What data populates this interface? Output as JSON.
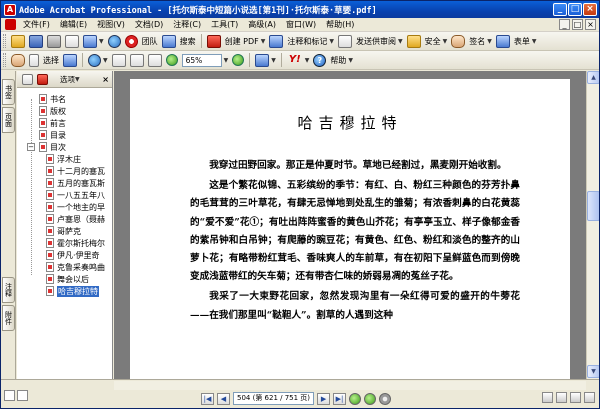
{
  "window": {
    "title": "Adobe Acrobat Professional - [托尔斯泰中短篇小说选[第1刊]·托尔斯泰·草婴.pdf]",
    "app_icon": "acrobat-icon",
    "buttons": [
      "_",
      "□",
      "×"
    ]
  },
  "menu": {
    "items": [
      "文件(F)",
      "编辑(E)",
      "视图(V)",
      "文档(D)",
      "注释(C)",
      "工具(T)",
      "高级(A)",
      "窗口(W)",
      "帮助(H)"
    ],
    "window_buttons": [
      "_",
      "□",
      "×"
    ]
  },
  "toolbar1": {
    "ie_label": "团队",
    "search_label": "搜索",
    "create_pdf_label": "创建 PDF",
    "comment_label": "注释和标记",
    "send_review_label": "发送供审阅",
    "secure_label": "安全",
    "sign_label": "签名",
    "forms_label": "表单"
  },
  "toolbar2": {
    "select_label": "选择",
    "zoom_value": "65%",
    "help_label": "帮助"
  },
  "nav_tabs": [
    "书签",
    "页面",
    "注释",
    "附件"
  ],
  "bookmarks": {
    "header_label": "选项",
    "items": [
      {
        "label": "书名",
        "level": 0
      },
      {
        "label": "版权",
        "level": 0
      },
      {
        "label": "前言",
        "level": 0
      },
      {
        "label": "目录",
        "level": 0
      },
      {
        "label": "目次",
        "level": 0,
        "expanded": true
      },
      {
        "label": "浮木庄",
        "level": 1
      },
      {
        "label": "十二月的塞瓦",
        "level": 1
      },
      {
        "label": "五月的塞瓦斯",
        "level": 1
      },
      {
        "label": "一八五五年八",
        "level": 1
      },
      {
        "label": "一个地主的早",
        "level": 1
      },
      {
        "label": "卢塞恩（聂赫",
        "level": 1
      },
      {
        "label": "哥萨克",
        "level": 1
      },
      {
        "label": "霍尔斯托梅尔",
        "level": 1
      },
      {
        "label": "伊凡·伊里奇",
        "level": 1
      },
      {
        "label": "克鲁采奏鸣曲",
        "level": 1
      },
      {
        "label": "舞会以后",
        "level": 1
      },
      {
        "label": "哈吉穆拉特",
        "level": 1,
        "selected": true
      }
    ]
  },
  "document": {
    "title": "哈吉穆拉特",
    "paragraphs": [
      "我穿过田野回家。那正是仲夏时节。草地已经割过，黑麦刚开始收割。",
      "这是个繁花似锦、五彩缤纷的季节：有红、白、粉红三种颜色的芬芳扑鼻的毛茸茸的三叶草花，有肆无忌惮地到处乱生的雏菊；有浓香刺鼻的白花黄蕊的“爱不爱”花①；有吐出阵阵蜜香的黄色山芥花；有亭亭玉立、样子像郁金香的紫吊钟和白吊钟；有爬藤的豌豆花；有黄色、红色、粉红和淡色的整齐的山萝卜花；有略带粉红茸毛、香味爽人的车前草，有在初阳下呈鲜蓝色而到傍晚变成浅蓝带红的矢车菊；还有带杏仁味的娇弱易凋的菟丝子花。",
      "我采了一大束野花回家，忽然发现沟里有一朵红得可爱的盛开的牛蒡花——在我们那里叫“鞑靼人”。割草的人遇到这种"
    ]
  },
  "status": {
    "page_field": "504 (第 621 / 751 页)"
  }
}
